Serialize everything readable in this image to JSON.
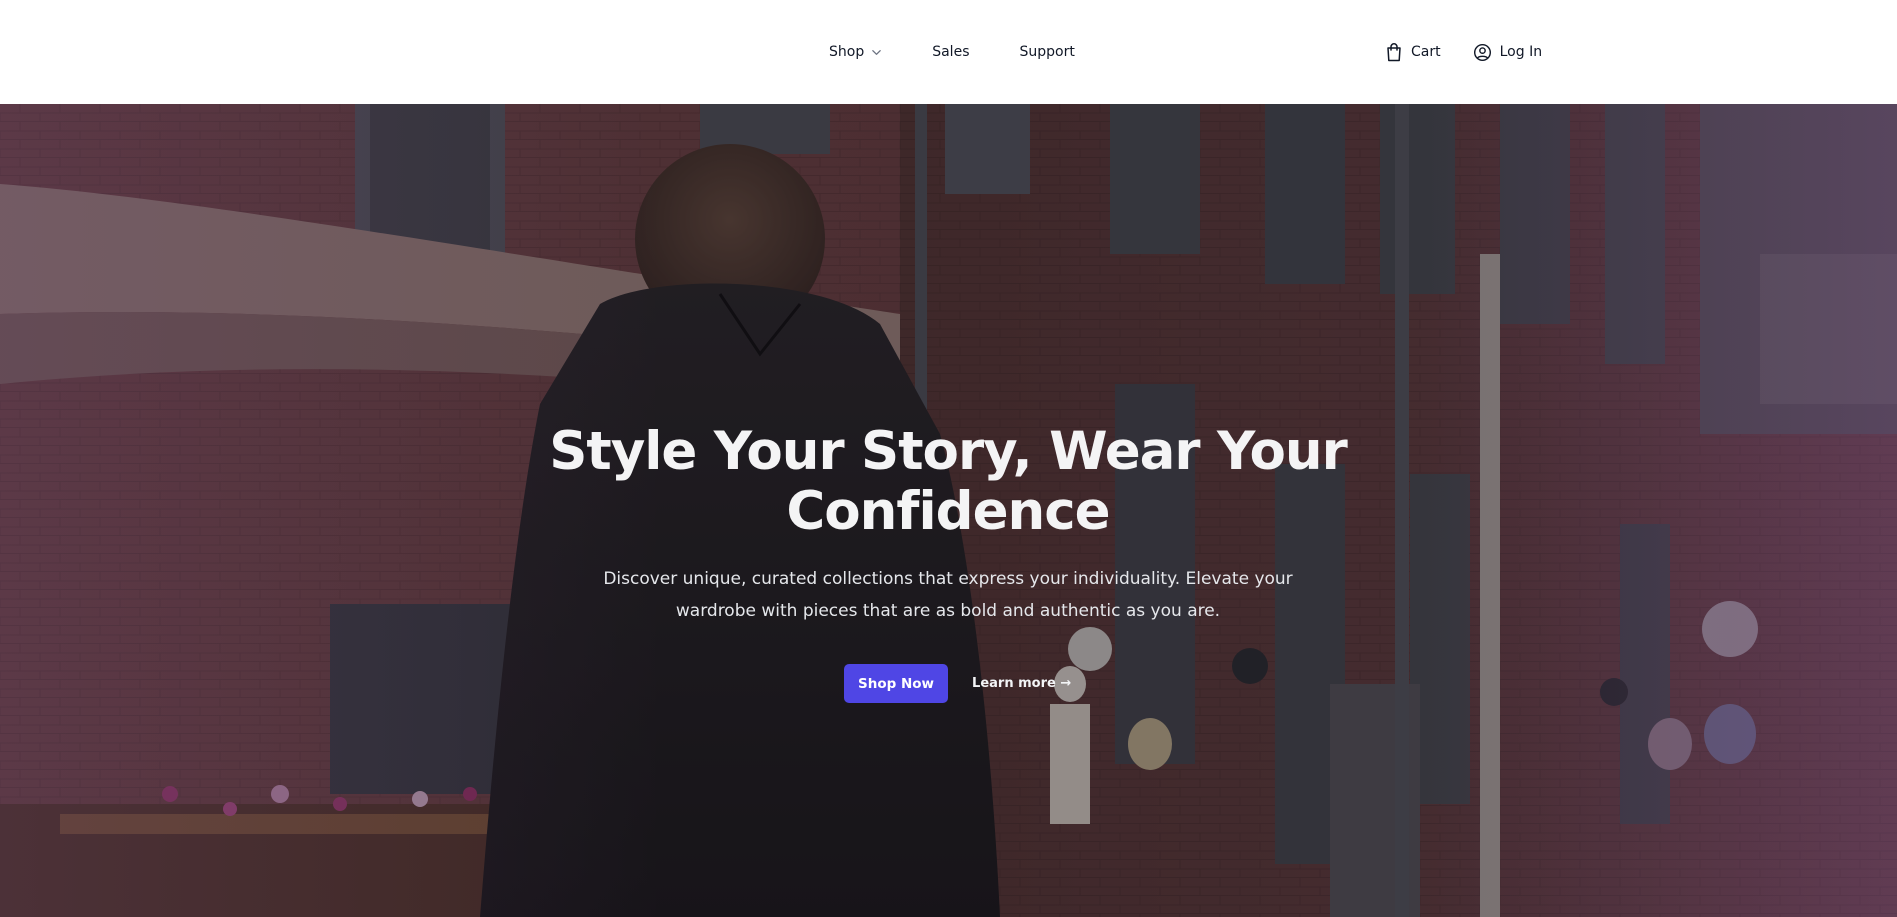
{
  "header": {
    "nav": {
      "shop": "Shop",
      "sales": "Sales",
      "support": "Support"
    },
    "actions": {
      "cart": "Cart",
      "login": "Log In"
    }
  },
  "hero": {
    "title": "Style Your Story, Wear Your Confidence",
    "subtitle": "Discover unique, curated collections that express your individuality. Elevate your wardrobe with pieces that are as bold and authentic as you are.",
    "primary_cta": "Shop Now",
    "secondary_cta": "Learn more →"
  },
  "colors": {
    "accent": "#4f46e5",
    "header_bg": "#ffffff",
    "nav_text": "#111827",
    "hero_text": "#f4f4f5"
  },
  "icons": {
    "shop_dropdown": "chevron-down-icon",
    "cart": "shopping-bag-icon",
    "login": "user-circle-icon"
  }
}
